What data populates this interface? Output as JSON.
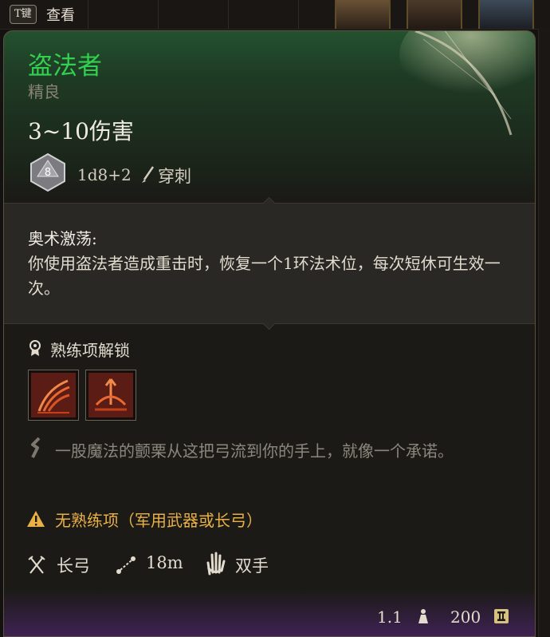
{
  "topbar": {
    "hotkey": "T键",
    "view_label": "查看"
  },
  "item": {
    "name": "盗法者",
    "rarity": "精良",
    "damage": "3~10伤害",
    "dice_value": "8",
    "dice_formula": "1d8+2",
    "damage_type": "穿刺"
  },
  "enchantment": {
    "title": "奥术激荡:",
    "description": "你使用盗法者造成重击时，恢复一个1环法术位，每次短休可生效一次。"
  },
  "proficiency": {
    "title": "熟练项解锁",
    "actions": [
      {
        "icon": "arrow-volley-icon"
      },
      {
        "icon": "arrow-crown-icon"
      }
    ]
  },
  "flavor_text": "一股魔法的颤栗从这把弓流到你的手上，就像一个承诺。",
  "warning": "无熟练项（军用武器或长弓）",
  "properties": {
    "weapon_type": "长弓",
    "range": "18m",
    "handedness": "双手"
  },
  "footer": {
    "weight": "1.1",
    "value": "200"
  },
  "colors": {
    "item_name": "#32d04f",
    "warning": "#e8b045",
    "card_top": "#24512f"
  }
}
